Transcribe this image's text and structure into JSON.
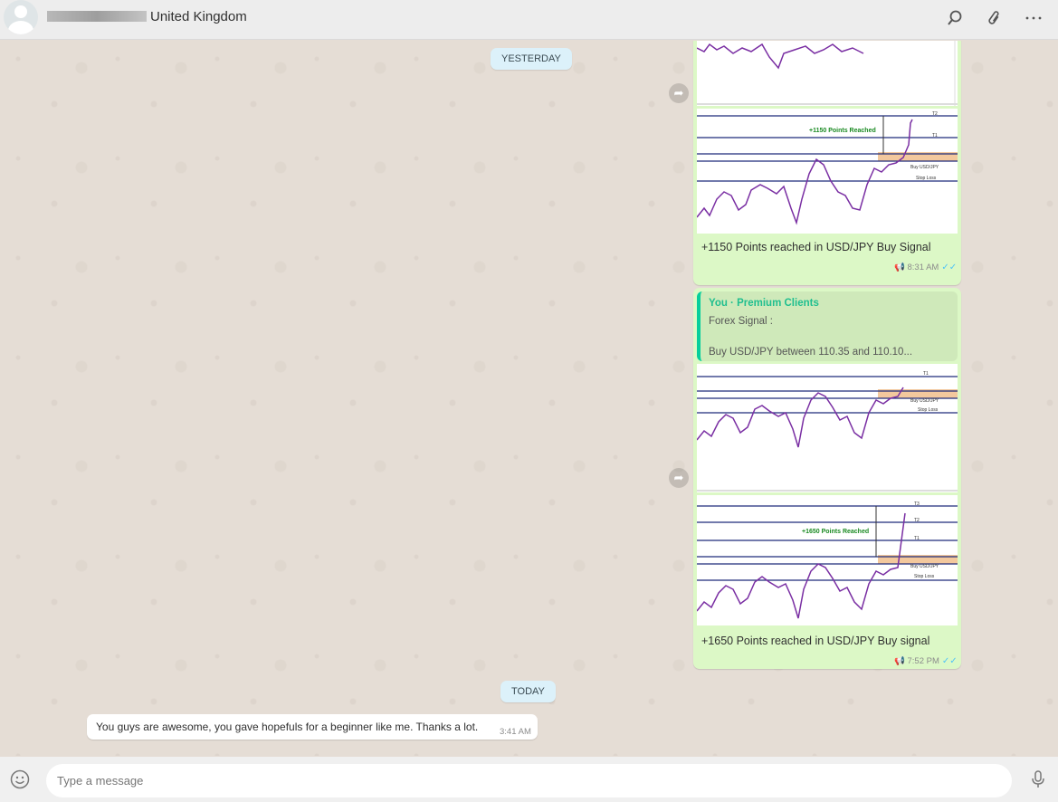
{
  "header": {
    "contact_name": "United Kingdom",
    "icons": [
      "search-icon",
      "attach-icon",
      "more-options-icon"
    ]
  },
  "chat": {
    "date_separators": [
      "YESTERDAY",
      "TODAY"
    ],
    "messages": [
      {
        "direction": "outgoing",
        "caption": "+1150 Points reached in USD/JPY Buy Signal",
        "time": "8:31 AM",
        "chart_labels": {
          "reached": "+1150 Points Reached",
          "t2": "T2",
          "t1": "T1",
          "buy": "Buy USD/JPY",
          "stop": "Stop Loss"
        }
      },
      {
        "direction": "outgoing",
        "quote": {
          "author": "You · Premium Clients",
          "line1": "Forex Signal :",
          "line2": "Buy USD/JPY between 110.35 and 110.10..."
        },
        "caption": "+1650 Points reached in USD/JPY Buy signal",
        "time": "7:52 PM",
        "chart_labels": {
          "reached": "+1650 Points Reached",
          "t3": "T3",
          "t2": "T2",
          "t1": "T1",
          "buy": "Buy USD/JPY",
          "stop": "Stop Loss"
        }
      },
      {
        "direction": "incoming",
        "text": "You guys are awesome, you gave hopefuls for a beginner like me. Thanks a lot.",
        "time": "3:41 AM"
      }
    ]
  },
  "footer": {
    "placeholder": "Type a message"
  }
}
